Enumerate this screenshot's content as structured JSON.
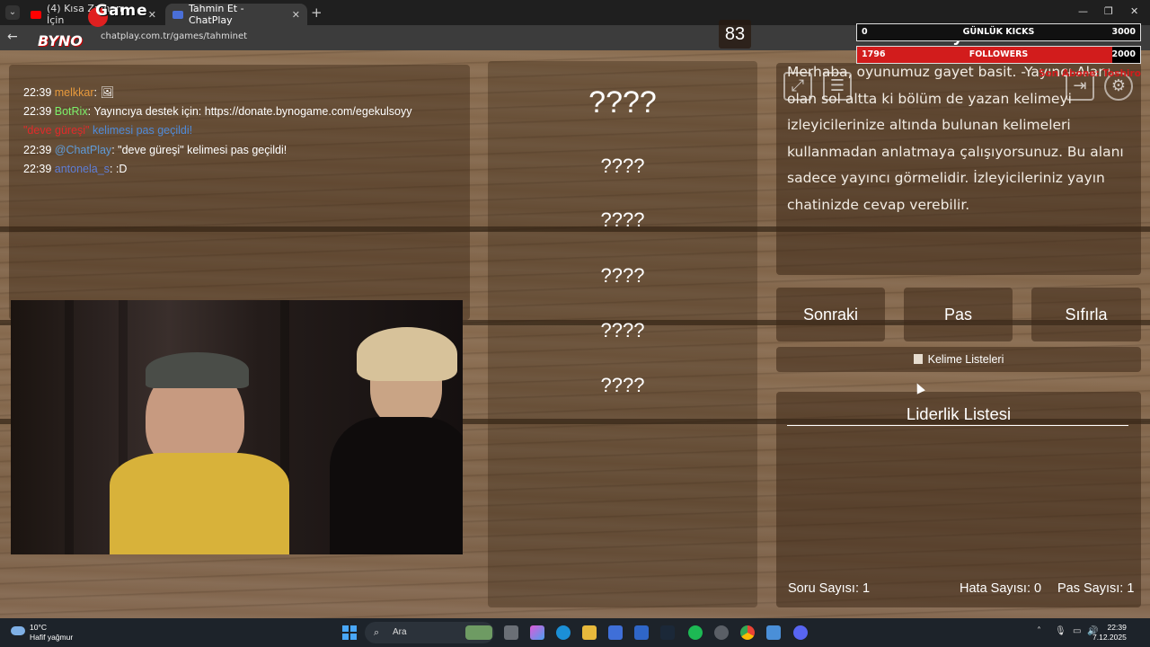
{
  "browser": {
    "tabs": [
      {
        "label": "(4) Kısa Zaman İçin",
        "favicon_color": "#ff0000"
      },
      {
        "label": "Tahmin Et - ChatPlay",
        "favicon_color": "#4a6fd8"
      }
    ],
    "url": "chatplay.com.tr/games/tahminet",
    "logo_top": "Game",
    "logo_bottom": "BYNO"
  },
  "overlay": {
    "kicks": {
      "current": "0",
      "label": "GÜNLÜK KICKS",
      "goal": "3000"
    },
    "followers": {
      "current": "1796",
      "label": "FOLLOWERS",
      "goal": "2000",
      "progress": 0.9
    },
    "last_sub": "Son Abone: Toshiro"
  },
  "chat": {
    "messages": [
      {
        "time": "22:39",
        "user": "melkkar",
        "user_color": "#e89a3c",
        "text": ": 🖼"
      },
      {
        "time": "22:39",
        "user": "BotRix",
        "user_color": "#7cf06a",
        "text": ": Yayıncıya destek için: https://donate.bynogame.com/egekulsoyy"
      },
      {
        "time": "",
        "user": "\"deve güreşi\"",
        "user_color": "#e02a2a",
        "text": " kelimesi pas geçildi!"
      },
      {
        "time": "22:39",
        "user": "@ChatPlay",
        "user_color": "#5f9bd8",
        "text": ": \"deve güreşi\" kelimesi pas geçildi!"
      },
      {
        "time": "22:39",
        "user": "antonela_s",
        "user_color": "#5f7fd8",
        "text": ": :D"
      }
    ]
  },
  "game": {
    "timer": "83",
    "main_word": "????",
    "forbidden_words": [
      "????",
      "????",
      "????",
      "????",
      "????"
    ]
  },
  "howto": {
    "title": "Nasıl Oynanır?",
    "text": "Merhaba, oyunumuz gayet basit. -Yayıncı Alanı- olan sol altta ki bölüm de yazan kelimeyi izleyicilerinize altında bulunan kelimeleri kullanmadan anlatmaya çalışıyorsunuz. Bu alanı sadece yayıncı görmelidir. İzleyicileriniz yayın chatinizde cevap verebilir.",
    "icons": [
      "fullscreen-icon",
      "list-icon",
      "exit-icon",
      "gear-icon"
    ]
  },
  "controls": {
    "next": "Sonraki",
    "pass": "Pas",
    "reset": "Sıfırla",
    "word_lists": "Kelime Listeleri"
  },
  "leaderboard": {
    "title": "Liderlik Listesi",
    "stats": {
      "questions": "Soru Sayısı: 1",
      "errors": "Hata Sayısı: 0",
      "passes": "Pas Sayısı: 1"
    }
  },
  "taskbar": {
    "weather_temp": "10°C",
    "weather_desc": "Hafif yağmur",
    "search_placeholder": "Ara",
    "time": "22:39",
    "date": "7.12.2025"
  }
}
